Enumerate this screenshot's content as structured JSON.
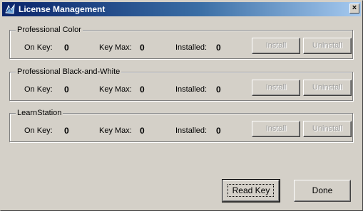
{
  "window": {
    "title": "License Management",
    "close_label": "×"
  },
  "groups": [
    {
      "name": "Professional Color",
      "on_key_label": "On Key:",
      "on_key_value": "0",
      "key_max_label": "Key Max:",
      "key_max_value": "0",
      "installed_label": "Installed:",
      "installed_value": "0",
      "install_label": "Install",
      "uninstall_label": "Uninstall"
    },
    {
      "name": "Professional Black-and-White",
      "on_key_label": "On Key:",
      "on_key_value": "0",
      "key_max_label": "Key Max:",
      "key_max_value": "0",
      "installed_label": "Installed:",
      "installed_value": "0",
      "install_label": "Install",
      "uninstall_label": "Uninstall"
    },
    {
      "name": "LearnStation",
      "on_key_label": "On Key:",
      "on_key_value": "0",
      "key_max_label": "Key Max:",
      "key_max_value": "0",
      "installed_label": "Installed:",
      "installed_value": "0",
      "install_label": "Install",
      "uninstall_label": "Uninstall"
    }
  ],
  "footer": {
    "read_key_label": "Read Key",
    "done_label": "Done"
  },
  "colors": {
    "titlebar_start": "#0a246a",
    "titlebar_end": "#a6caf0",
    "face": "#d4d0c8",
    "disabled_text": "#a0a0a0"
  },
  "icons": [
    "app-icon",
    "close-icon"
  ]
}
